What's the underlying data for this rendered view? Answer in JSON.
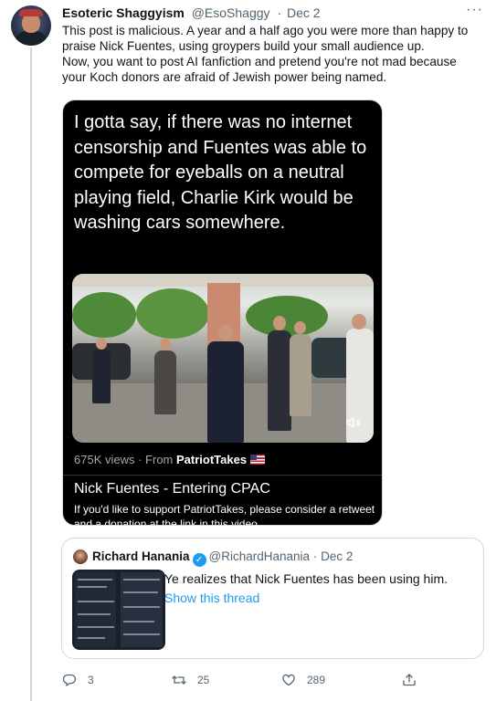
{
  "tweet": {
    "author_name": "Esoteric Shaggyism",
    "author_handle": "@EsoShaggy",
    "separator": "·",
    "date": "Dec 2",
    "more_label": "···",
    "text": "This post is malicious. A year and a half ago you were more than happy to\npraise Nick Fuentes, using groypers build your small audience up.\nNow, you want to post AI fanfiction and pretend you're not mad because\nyour Koch donors are afraid of Jewish power being named."
  },
  "media": {
    "big_text": "I gotta say, if there was no internet censorship and Fuentes was able to compete for eyeballs on a neutral playing field, Charlie Kirk would be washing cars somewhere.",
    "views": "675K views",
    "from_label": "· From",
    "source": "PatriotTakes",
    "video_title": "Nick Fuentes - Entering CPAC",
    "video_desc": "If you'd like to support PatriotTakes, please consider a retweet and a donation at the link in this video",
    "mute_icon": "speaker-muted-icon"
  },
  "quote": {
    "name": "Richard Hanania",
    "verified_glyph": "✓",
    "handle": "@RichardHanania",
    "separator": "·",
    "date": "Dec 2",
    "text": "Ye realizes that Nick Fuentes has been using him.",
    "link": "Show this thread"
  },
  "actions": {
    "replies": "3",
    "retweets": "25",
    "likes": "289"
  },
  "colors": {
    "accent": "#1d9bf0",
    "text_secondary": "#536471",
    "border": "#cfd9de"
  }
}
